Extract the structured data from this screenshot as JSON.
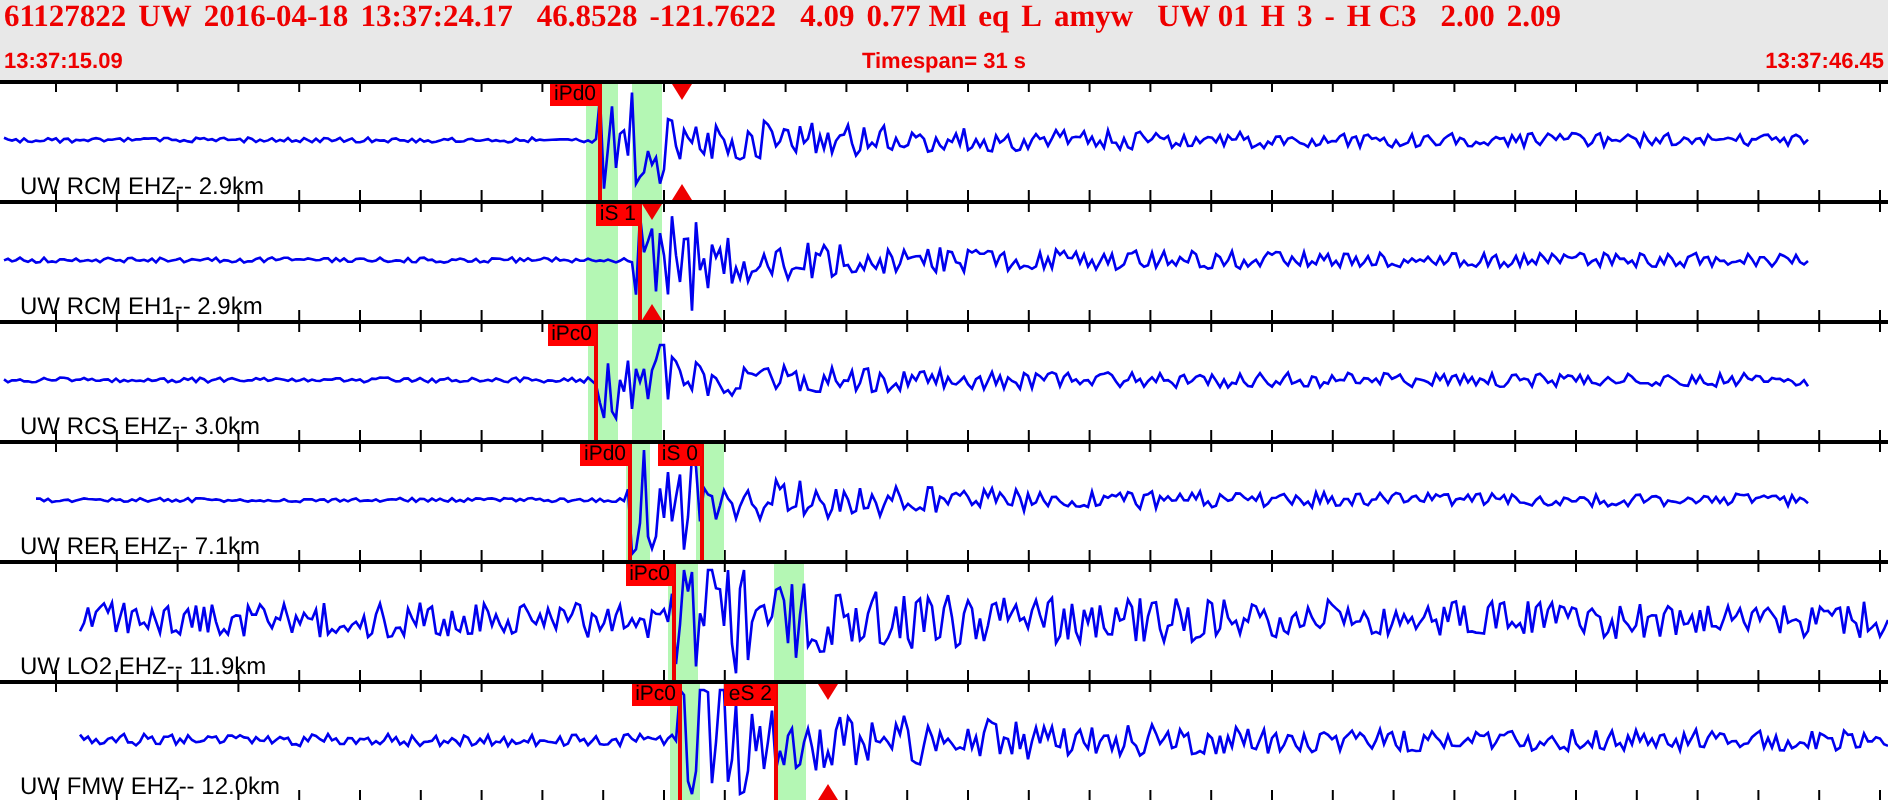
{
  "header": {
    "event": [
      "61127822",
      "UW",
      "2016-04-18",
      "13:37:24.17",
      "46.8528",
      "-121.7622",
      "4.09",
      "0.77 Ml",
      "eq",
      "L",
      "amyw",
      "UW 01",
      "H",
      "3",
      "-",
      "H C3",
      "2.00",
      "2.09"
    ],
    "start_time": "13:37:15.09",
    "timespan": "Timespan=  31 s",
    "end_time": "13:37:46.45"
  },
  "traces": [
    {
      "label": "UW RCM EHZ-- 2.9km",
      "picks": [
        {
          "label": "iPd0"
        }
      ]
    },
    {
      "label": "UW RCM EH1-- 2.9km",
      "picks": [
        {
          "label": "iS 1"
        }
      ]
    },
    {
      "label": "UW RCS EHZ-- 3.0km",
      "picks": [
        {
          "label": "iPc0"
        }
      ]
    },
    {
      "label": "UW RER EHZ-- 7.1km",
      "picks": [
        {
          "label": "iPd0"
        },
        {
          "label": "iS 0"
        }
      ]
    },
    {
      "label": "UW LO2 EHZ-- 11.9km",
      "picks": [
        {
          "label": "iPc0"
        }
      ]
    },
    {
      "label": "UW FMW EHZ-- 12.0km",
      "picks": [
        {
          "label": "iPc0"
        },
        {
          "label": "eS 2"
        }
      ]
    }
  ]
}
